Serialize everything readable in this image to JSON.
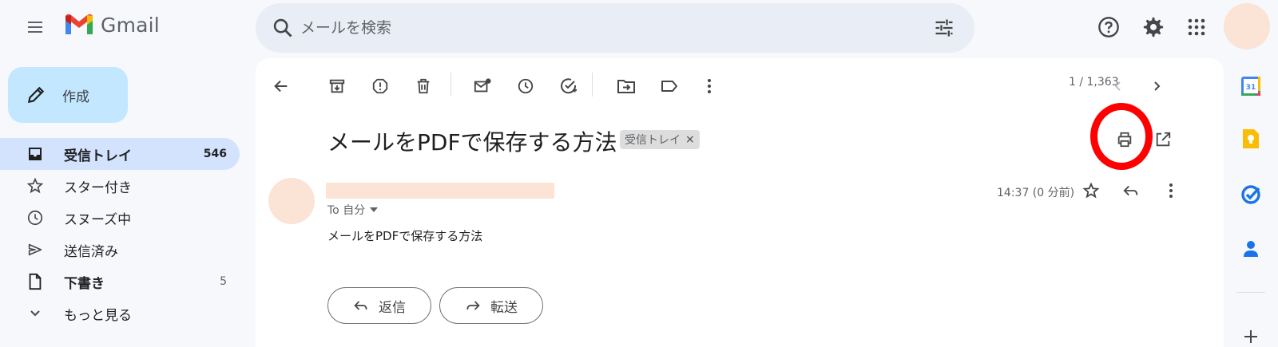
{
  "app": {
    "name": "Gmail"
  },
  "search": {
    "placeholder": "メールを検索"
  },
  "sidebar": {
    "compose_label": "作成",
    "items": [
      {
        "label": "受信トレイ",
        "count": "546",
        "icon": "inbox-icon",
        "active": true
      },
      {
        "label": "スター付き",
        "count": "",
        "icon": "star-icon"
      },
      {
        "label": "スヌーズ中",
        "count": "",
        "icon": "clock-icon"
      },
      {
        "label": "送信済み",
        "count": "",
        "icon": "send-icon"
      },
      {
        "label": "下書き",
        "count": "5",
        "icon": "draft-icon"
      },
      {
        "label": "もっと見る",
        "count": "",
        "icon": "chevron-down-icon"
      }
    ]
  },
  "toolbar": {
    "page_range": "1 / 1,363"
  },
  "message": {
    "subject": "メールをPDFで保存する方法",
    "label_chip": "受信トレイ",
    "label_chip_close": "×",
    "to": "To 自分",
    "timestamp": "14:37 (0 分前)",
    "body": "メールをPDFで保存する方法",
    "reply_label": "返信",
    "forward_label": "転送"
  },
  "colors": {
    "accent_compose": "#c2e7ff",
    "active_nav": "#d3e3fd",
    "highlight_ring": "#ff0000",
    "avatar_placeholder": "#fbe3d5"
  },
  "side_apps": {
    "calendar_day": "31"
  }
}
